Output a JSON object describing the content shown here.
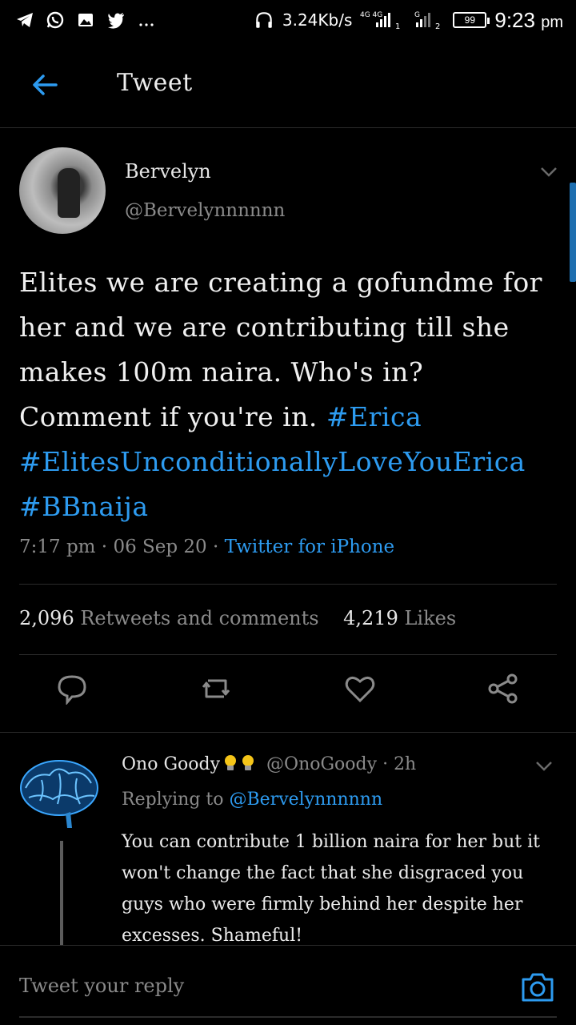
{
  "status_bar": {
    "network_speed": "3.24Kb/s",
    "network_type": "4G 4G",
    "sim1": "1",
    "sim2": "2",
    "sim2_type": "G",
    "battery": "99",
    "time": "9:23",
    "ampm": "pm",
    "left_icons": [
      "telegram-icon",
      "whatsapp-icon",
      "gallery-icon",
      "twitter-icon",
      "more-icon"
    ]
  },
  "header": {
    "title": "Tweet"
  },
  "tweet": {
    "author_name": "Bervelyn",
    "author_handle": "@Bervelynnnnnn",
    "text_plain": "Elites we are creating a gofundme for her and we are contributing till she makes 100m naira. Who's in? Comment if you're in.",
    "hashtags": [
      "#Erica",
      "#ElitesUnconditionallyLoveYouErica",
      "#BBnaija"
    ],
    "time": "7:17 pm",
    "date": "06 Sep 20",
    "source": "Twitter for iPhone",
    "retweets_count": "2,096",
    "retweets_label": "Retweets and comments",
    "likes_count": "4,219",
    "likes_label": "Likes"
  },
  "reply": {
    "author_name": "Ono Goody",
    "author_handle": "@OnoGoody",
    "age": "2h",
    "replying_label": "Replying to",
    "replying_handle": "@Bervelynnnnnn",
    "text": "You can contribute 1 billion naira for her but it won't change the fact that she disgraced you guys who were firmly behind her despite her excesses. Shameful!"
  },
  "composer": {
    "placeholder": "Tweet your reply"
  },
  "colors": {
    "accent": "#2d9bf0",
    "background": "#000000",
    "secondary_text": "#8a8a8a"
  }
}
